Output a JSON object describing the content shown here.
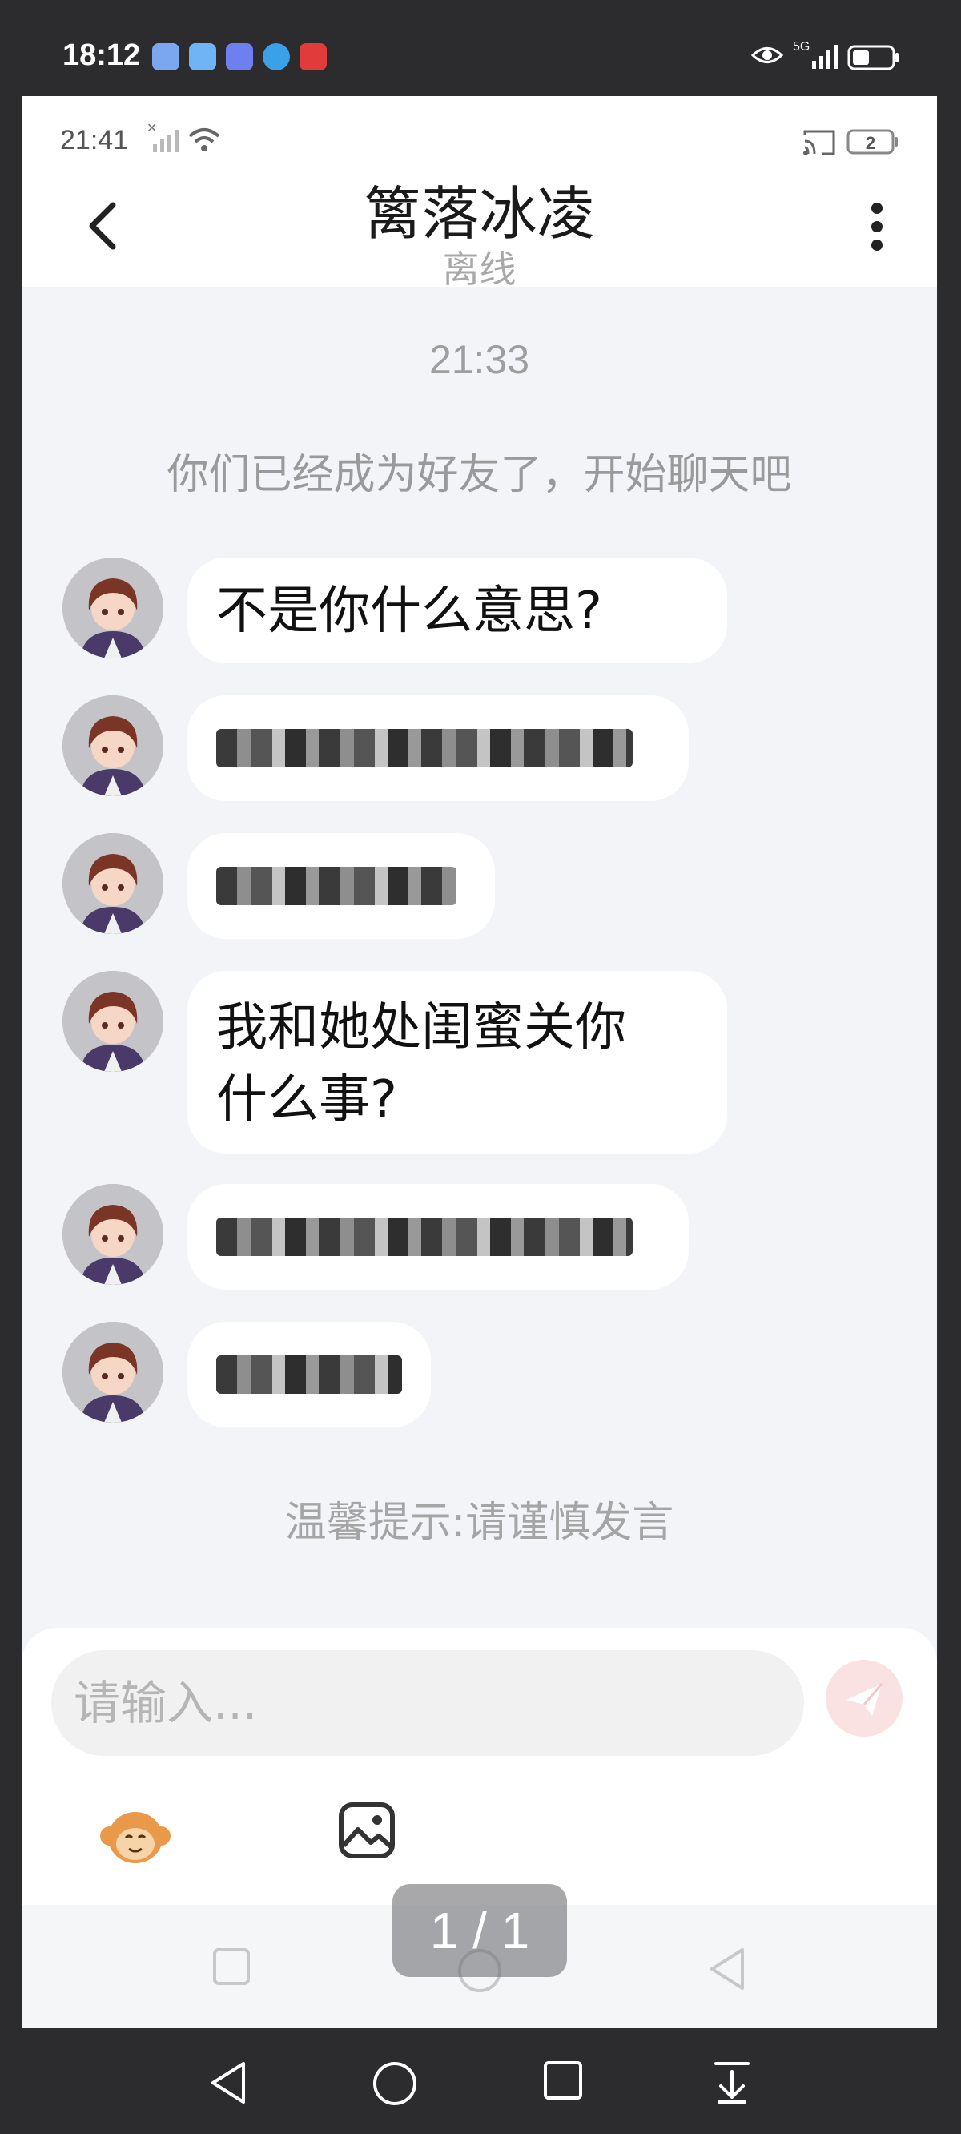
{
  "phone_status": {
    "time": "18:12",
    "network": "5G",
    "app_icons": [
      "weather-app-icon",
      "reader-app-icon",
      "mail-app-icon",
      "search-app-icon",
      "shopping-618-app-icon"
    ],
    "app_icon_colors": [
      "#7aa7f0",
      "#6fb5f5",
      "#6e7ff0",
      "#3aa0e8",
      "#e23b3b"
    ]
  },
  "screenshot_status": {
    "time": "21:41",
    "battery": "2"
  },
  "chat_header": {
    "title": "篱落冰凌",
    "status": "离线"
  },
  "conversation": {
    "timestamp": "21:33",
    "system_note": "你们已经成为好友了，开始聊天吧",
    "messages": [
      {
        "type": "text",
        "lines": [
          "不是你什么意思?"
        ]
      },
      {
        "type": "redacted"
      },
      {
        "type": "redacted"
      },
      {
        "type": "text",
        "lines": [
          "我和她处闺蜜关你",
          "什么事?"
        ]
      },
      {
        "type": "redacted"
      },
      {
        "type": "redacted"
      }
    ],
    "warm_tip": "温馨提示:请谨慎发言"
  },
  "composer": {
    "placeholder": "请输入...",
    "send_icon": "paper-plane-icon",
    "emoji_icon": "monkey-emoji-icon",
    "image_icon": "image-icon"
  },
  "viewer": {
    "page_indicator": "1 / 1"
  },
  "colors": {
    "chat_background": "#f2f4f7",
    "send_button": "#fbe2e2",
    "muted_text": "#a5a5a5"
  }
}
